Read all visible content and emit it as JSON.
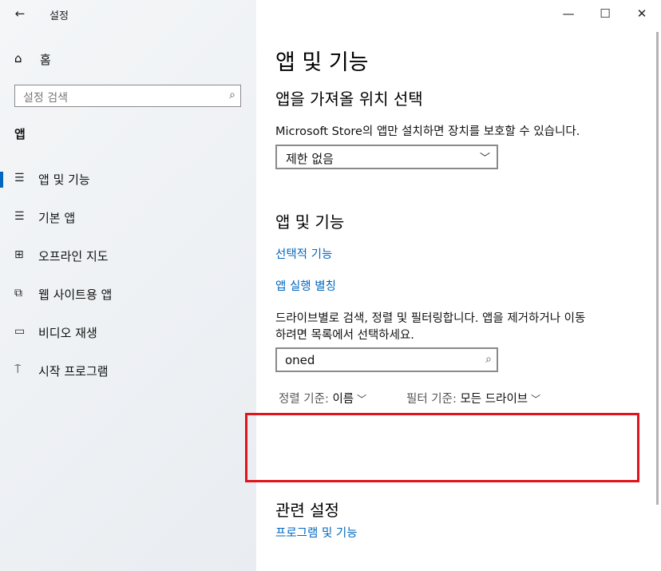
{
  "window": {
    "title": "설정",
    "back_glyph": "←",
    "controls": {
      "minimize": "—",
      "maximize": "☐",
      "close": "✕"
    }
  },
  "sidebar": {
    "home": {
      "icon": "home-icon",
      "glyph": "⌂",
      "label": "홈"
    },
    "search": {
      "placeholder": "설정 검색",
      "icon": "search-icon"
    },
    "section_title": "앱",
    "items": [
      {
        "label": "앱 및 기능",
        "icon": "list-icon",
        "glyph": "☰",
        "active": true
      },
      {
        "label": "기본 앱",
        "icon": "default-apps-icon",
        "glyph": "☰",
        "active": false
      },
      {
        "label": "오프라인 지도",
        "icon": "map-icon",
        "glyph": "⊞",
        "active": false
      },
      {
        "label": "웹 사이트용 앱",
        "icon": "web-app-icon",
        "glyph": "⧉",
        "active": false
      },
      {
        "label": "비디오 재생",
        "icon": "video-icon",
        "glyph": "▭",
        "active": false
      },
      {
        "label": "시작 프로그램",
        "icon": "startup-icon",
        "glyph": "⍑",
        "active": false
      }
    ]
  },
  "main": {
    "title": "앱 및 기능",
    "install_source": {
      "heading": "앱을 가져올 위치 선택",
      "description": "Microsoft Store의 앱만 설치하면 장치를 보호할 수 있습니다.",
      "dropdown_value": "제한 없음"
    },
    "apps_features": {
      "heading": "앱 및 기능",
      "link_optional": "선택적 기능",
      "link_aliases": "앱 실행 별칭",
      "description_line1": "드라이브별로 검색, 정렬 및 필터링합니다. 앱을 제거하거나 이동",
      "description_line2": "하려면 목록에서 선택하세요.",
      "filter_value": "oned",
      "sort_label": "정렬 기준:",
      "sort_value": "이름",
      "filter_label": "필터 기준:",
      "filter_drive": "모든 드라이브"
    },
    "related": {
      "heading": "관련 설정",
      "link_programs": "프로그램 및 기능"
    }
  },
  "colors": {
    "accent": "#0067c0",
    "highlight_box": "#e0141a"
  }
}
